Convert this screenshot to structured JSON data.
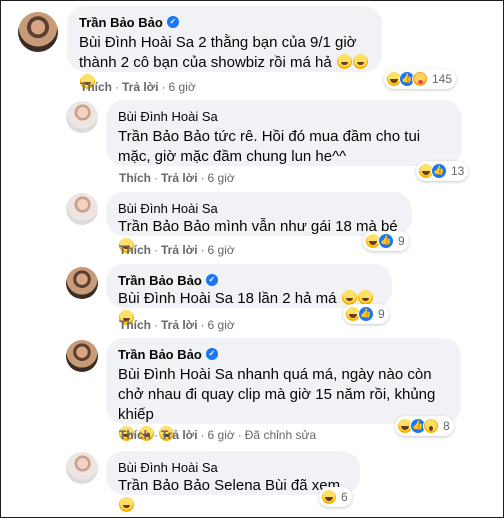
{
  "actions": {
    "like": "Thích",
    "reply": "Trả lời",
    "edited": "Đã chỉnh sửa"
  },
  "comments": [
    {
      "author": "Trần Bảo Bảo",
      "verified": true,
      "text": "Bùi Đình Hoài Sa 2 thằng bạn của 9/1 giờ thành 2 cô bạn của showbiz rồi má hả",
      "emoji_count": 3,
      "time": "6 giờ",
      "reactions": [
        "haha",
        "like",
        "care"
      ],
      "reaction_count": "145"
    },
    {
      "author": "Bùi Đình Hoài Sa",
      "verified": false,
      "text": "Trần Bảo Bảo tức rê. Hồi đó mua đầm cho tui mặc, giờ mặc đầm chung lun he^^",
      "emoji_count": 0,
      "time": "6 giờ",
      "reactions": [
        "haha",
        "like"
      ],
      "reaction_count": "13"
    },
    {
      "author": "Bùi Đình Hoài Sa",
      "verified": false,
      "text": "Trần Bảo Bảo mình vẫn như gái 18 mà bé",
      "emoji_count": 1,
      "time": "6 giờ",
      "reactions": [
        "haha",
        "like"
      ],
      "reaction_count": "9"
    },
    {
      "author": "Trần Bảo Bảo",
      "verified": true,
      "text": "Bùi Đình Hoài Sa 18 lần 2 hả má",
      "emoji_count": 3,
      "time": "6 giờ",
      "reactions": [
        "haha",
        "like"
      ],
      "reaction_count": "9"
    },
    {
      "author": "Trần Bảo Bảo",
      "verified": true,
      "text": "Bùi Đình Hoài Sa nhanh quá má, ngày nào còn chở nhau đi quay clip mà giờ 15 năm rồi, khủng khiếp",
      "emoji_count": 3,
      "time": "6 giờ",
      "reactions": [
        "haha",
        "like",
        "wow"
      ],
      "reaction_count": "8",
      "edited": true
    },
    {
      "author": "Bùi Đình Hoài Sa",
      "verified": false,
      "text": "Trần Bảo Bảo Selena Bùi đã xem",
      "emoji_count": 1,
      "time": "",
      "reactions": [
        "haha"
      ],
      "reaction_count": "6"
    }
  ]
}
